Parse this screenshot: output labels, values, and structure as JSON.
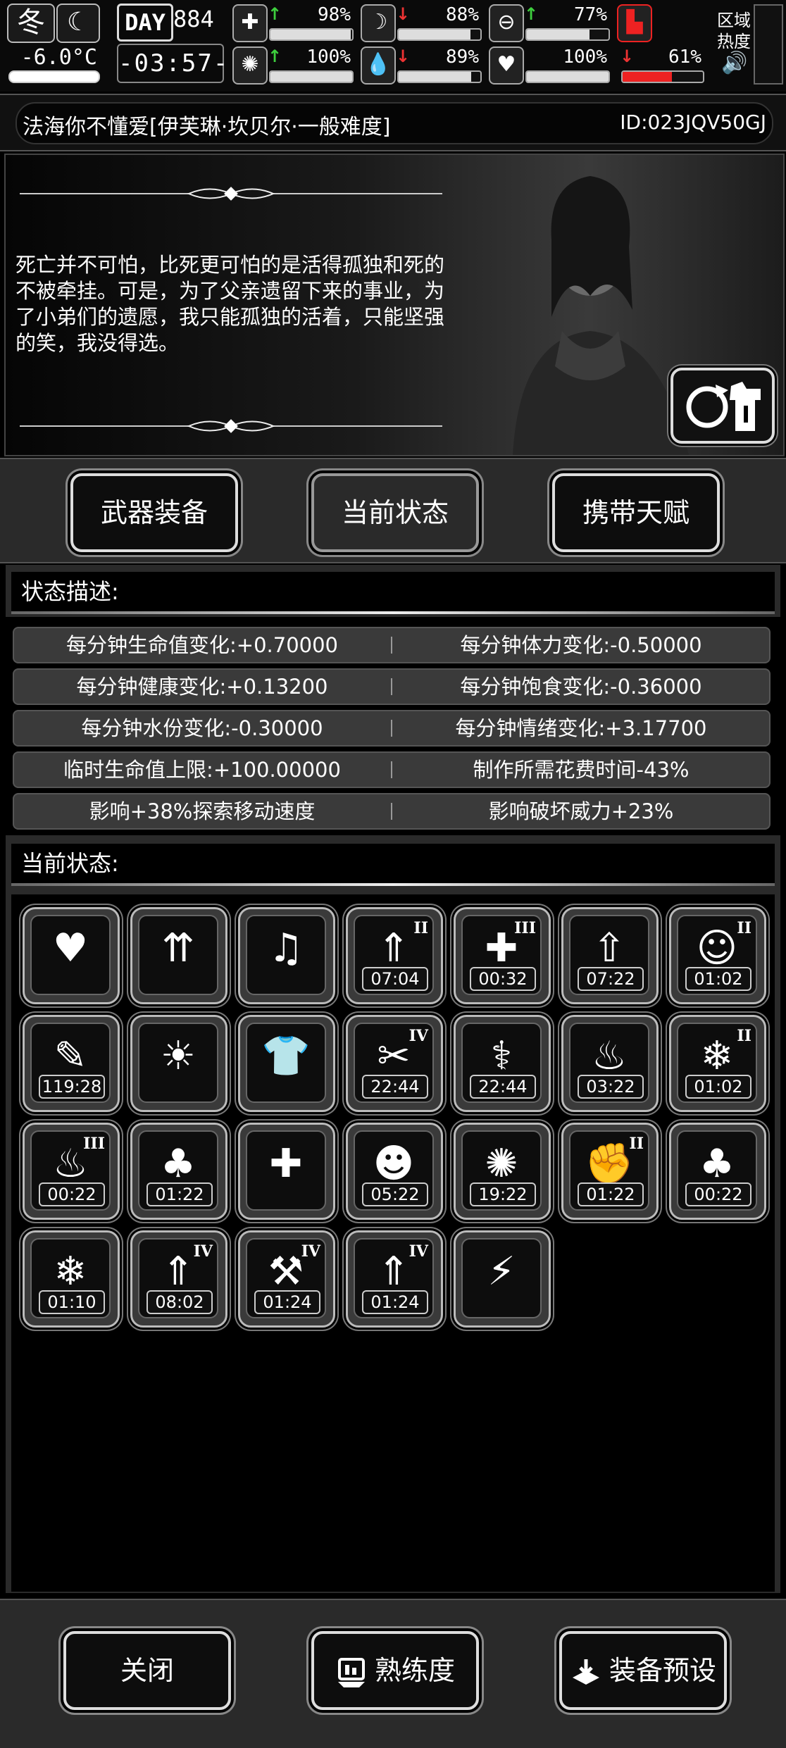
{
  "hud": {
    "season": "冬",
    "temperature": "-6.0°C",
    "day_label": "DAY",
    "day_number": "884",
    "clock": "-03:57-",
    "stats": [
      {
        "name": "health",
        "icon": "medkit-icon",
        "arrow": "up",
        "percent": "98%",
        "level": 0.98
      },
      {
        "name": "hunger",
        "icon": "stomach-icon",
        "arrow": "down",
        "percent": "88%",
        "level": 0.88
      },
      {
        "name": "stamina",
        "icon": "capsule-icon",
        "arrow": "up",
        "percent": "77%",
        "level": 0.77
      },
      {
        "name": "armor",
        "icon": "boot-icon",
        "arrow": "",
        "percent": "",
        "level": 0
      },
      {
        "name": "brain",
        "icon": "brain-icon",
        "arrow": "up",
        "percent": "100%",
        "level": 1.0
      },
      {
        "name": "water",
        "icon": "water-drop-icon",
        "arrow": "down",
        "percent": "89%",
        "level": 0.89
      },
      {
        "name": "mood",
        "icon": "heart-icon",
        "arrow": "",
        "percent": "100%",
        "level": 1.0
      },
      {
        "name": "temperature",
        "icon": "",
        "arrow": "down",
        "percent": "61%",
        "level": 0.61
      }
    ],
    "area_heat_label": "区域热度"
  },
  "title": {
    "text": "法海你不懂爱[伊芙琳·坎贝尔·一般难度]",
    "id": "ID:023JQV50GJ"
  },
  "story": {
    "quote": "死亡并不可怕，比死更可怕的是活得孤独和死的不被牵挂。可是，为了父亲遗留下来的事业，为了小弟们的遗愿，我只能孤独的活着，只能坚强的笑，我没得选。"
  },
  "tabs": {
    "weapons": "武器装备",
    "status": "当前状态",
    "talents": "携带天赋"
  },
  "description": {
    "header": "状态描述:",
    "rows": [
      [
        "每分钟生命值变化:+0.70000",
        "每分钟体力变化:-0.50000"
      ],
      [
        "每分钟健康变化:+0.13200",
        "每分钟饱食变化:-0.36000"
      ],
      [
        "每分钟水份变化:-0.30000",
        "每分钟情绪变化:+3.17700"
      ],
      [
        "临时生命值上限:+100.00000",
        "制作所需花费时间-43%"
      ],
      [
        "影响+38%探索移动速度",
        "影响破坏威力+23%"
      ]
    ]
  },
  "current_status": {
    "header": "当前状态:",
    "effects": [
      {
        "icon": "heart-icon",
        "glyph": "♥",
        "roman": "",
        "timer": ""
      },
      {
        "icon": "stomach-growth-icon",
        "glyph": "⇈",
        "roman": "",
        "timer": ""
      },
      {
        "icon": "music-heart-icon",
        "glyph": "♫",
        "roman": "",
        "timer": ""
      },
      {
        "icon": "stat-boost-icon",
        "glyph": "⇑",
        "roman": "II",
        "timer": "07:04"
      },
      {
        "icon": "medical-boost-icon",
        "glyph": "✚",
        "roman": "III",
        "timer": "00:32"
      },
      {
        "icon": "food-boost-icon",
        "glyph": "⇧",
        "roman": "",
        "timer": "07:22"
      },
      {
        "icon": "happy-face-icon",
        "glyph": "☺",
        "roman": "II",
        "timer": "01:02"
      },
      {
        "icon": "syringe-icon",
        "glyph": "✎",
        "roman": "",
        "timer": "119:28"
      },
      {
        "icon": "alarm-person-icon",
        "glyph": "☀",
        "roman": "",
        "timer": ""
      },
      {
        "icon": "shirt-icon",
        "glyph": "👕",
        "roman": "",
        "timer": ""
      },
      {
        "icon": "bandage-arm-icon",
        "glyph": "✂",
        "roman": "IV",
        "timer": "22:44"
      },
      {
        "icon": "dna-icon",
        "glyph": "⚕",
        "roman": "",
        "timer": "22:44"
      },
      {
        "icon": "meal-icon",
        "glyph": "♨",
        "roman": "",
        "timer": "03:22"
      },
      {
        "icon": "frozen-food-icon",
        "glyph": "❄",
        "roman": "II",
        "timer": "01:02"
      },
      {
        "icon": "hot-dish-icon",
        "glyph": "♨",
        "roman": "III",
        "timer": "00:22"
      },
      {
        "icon": "food-bag-icon",
        "glyph": "♣",
        "roman": "",
        "timer": "01:22"
      },
      {
        "icon": "medicine-icon",
        "glyph": "✚",
        "roman": "",
        "timer": ""
      },
      {
        "icon": "sleepy-person-icon",
        "glyph": "☻",
        "roman": "",
        "timer": "05:22"
      },
      {
        "icon": "brain-icon",
        "glyph": "✺",
        "roman": "",
        "timer": "19:22"
      },
      {
        "icon": "fist-icon",
        "glyph": "✊",
        "roman": "II",
        "timer": "01:22"
      },
      {
        "icon": "food-bag-icon",
        "glyph": "♣",
        "roman": "",
        "timer": "00:22"
      },
      {
        "icon": "frozen-bag-icon",
        "glyph": "❄",
        "roman": "",
        "timer": "01:10"
      },
      {
        "icon": "drink-boost-icon",
        "glyph": "⇑",
        "roman": "IV",
        "timer": "08:02"
      },
      {
        "icon": "tool-boost-icon",
        "glyph": "⚒",
        "roman": "IV",
        "timer": "01:24"
      },
      {
        "icon": "trap-boost-icon",
        "glyph": "⇑",
        "roman": "IV",
        "timer": "01:24"
      },
      {
        "icon": "swift-foot-icon",
        "glyph": "⚡",
        "roman": "",
        "timer": ""
      }
    ]
  },
  "bottom": {
    "close": "关闭",
    "proficiency": "熟练度",
    "preset": "装备预设"
  },
  "colors": {
    "up_arrow": "#3ecf3e",
    "down_arrow": "#e33333",
    "low_bar": "#e22222"
  }
}
